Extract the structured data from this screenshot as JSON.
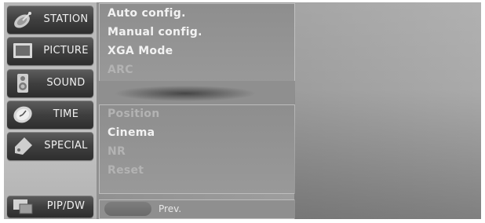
{
  "nav": {
    "items": [
      {
        "label": "STATION",
        "icon": "satellite-dish-icon"
      },
      {
        "label": "PICTURE",
        "icon": "monitor-icon"
      },
      {
        "label": "SOUND",
        "icon": "speaker-icon"
      },
      {
        "label": "TIME",
        "icon": "clock-icon"
      },
      {
        "label": "SPECIAL",
        "icon": "tag-icon"
      },
      {
        "label": "PIP/DW",
        "icon": "pip-windows-icon"
      }
    ]
  },
  "menu": {
    "top_items": [
      {
        "label": "Auto config.",
        "state": "enabled"
      },
      {
        "label": "Manual config.",
        "state": "highlighted"
      },
      {
        "label": "XGA Mode",
        "state": "enabled"
      },
      {
        "label": "ARC",
        "state": "disabled"
      }
    ],
    "bottom_items": [
      {
        "label": "Position",
        "state": "disabled"
      },
      {
        "label": "Cinema",
        "state": "enabled"
      },
      {
        "label": "NR",
        "state": "disabled"
      },
      {
        "label": "Reset",
        "state": "disabled"
      }
    ]
  },
  "footer": {
    "prev_label": "Prev."
  },
  "colors": {
    "nav_button": "#3f3f3f",
    "menu_text": "#f2f2f2",
    "menu_text_disabled": "#b3b3b3",
    "menu_bg": "#939393"
  }
}
